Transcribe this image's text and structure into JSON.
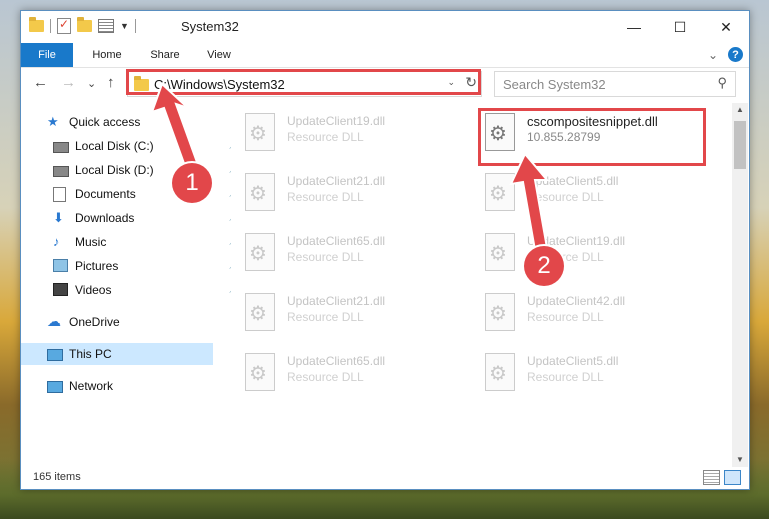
{
  "window": {
    "title": "System32",
    "controls": {
      "minimize": "—",
      "maximize": "☐",
      "close": "✕"
    }
  },
  "ribbon": {
    "tabs": [
      {
        "label": "File"
      },
      {
        "label": "Home"
      },
      {
        "label": "Share"
      },
      {
        "label": "View"
      }
    ],
    "help": "?",
    "expand_caret": "⌄"
  },
  "address": {
    "path": "C:\\Windows\\System32",
    "dropdown": "⌄",
    "refresh": "↻"
  },
  "search": {
    "placeholder": "Search System32"
  },
  "nav": {
    "back": "←",
    "forward": "→",
    "recent": "⌄",
    "up": "↑"
  },
  "sidebar": {
    "items": [
      {
        "label": "Quick access",
        "icon": "star-icon"
      },
      {
        "label": "Local Disk (C:)",
        "icon": "drive-icon",
        "pinned": true
      },
      {
        "label": "Local Disk (D:)",
        "icon": "drive-icon",
        "pinned": true
      },
      {
        "label": "Documents",
        "icon": "documents-icon",
        "pinned": true
      },
      {
        "label": "Downloads",
        "icon": "downloads-icon",
        "pinned": true
      },
      {
        "label": "Music",
        "icon": "music-icon",
        "pinned": true
      },
      {
        "label": "Pictures",
        "icon": "pictures-icon",
        "pinned": true
      },
      {
        "label": "Videos",
        "icon": "videos-icon",
        "pinned": true
      },
      {
        "label": "OneDrive",
        "icon": "onedrive-icon"
      },
      {
        "label": "This PC",
        "icon": "pc-icon",
        "selected": true
      },
      {
        "label": "Network",
        "icon": "network-icon"
      }
    ]
  },
  "files": {
    "left": [
      {
        "name": "UpdateClient19.dll",
        "type": "Resource DLL"
      },
      {
        "name": "UpdateClient21.dll",
        "type": "Resource DLL"
      },
      {
        "name": "UpdateClient65.dll",
        "type": "Resource DLL"
      },
      {
        "name": "UpdateClient21.dll",
        "type": "Resource DLL"
      },
      {
        "name": "UpdateClient65.dll",
        "type": "Resource DLL"
      }
    ],
    "right": [
      {
        "name": "cscompositesnippet.dll",
        "type": "10.855.28799"
      },
      {
        "name": "UpdateClient5.dll",
        "type": "Resource DLL"
      },
      {
        "name": "UpdateClient19.dll",
        "type": "Resource DLL"
      },
      {
        "name": "UpdateClient42.dll",
        "type": "Resource DLL"
      },
      {
        "name": "UpdateClient5.dll",
        "type": "Resource DLL"
      }
    ]
  },
  "status": {
    "count": "165 items"
  },
  "callouts": {
    "one": "1",
    "two": "2"
  },
  "colors": {
    "accent": "#1979ca",
    "callout": "#e2474a",
    "selected": "#cce8ff"
  }
}
